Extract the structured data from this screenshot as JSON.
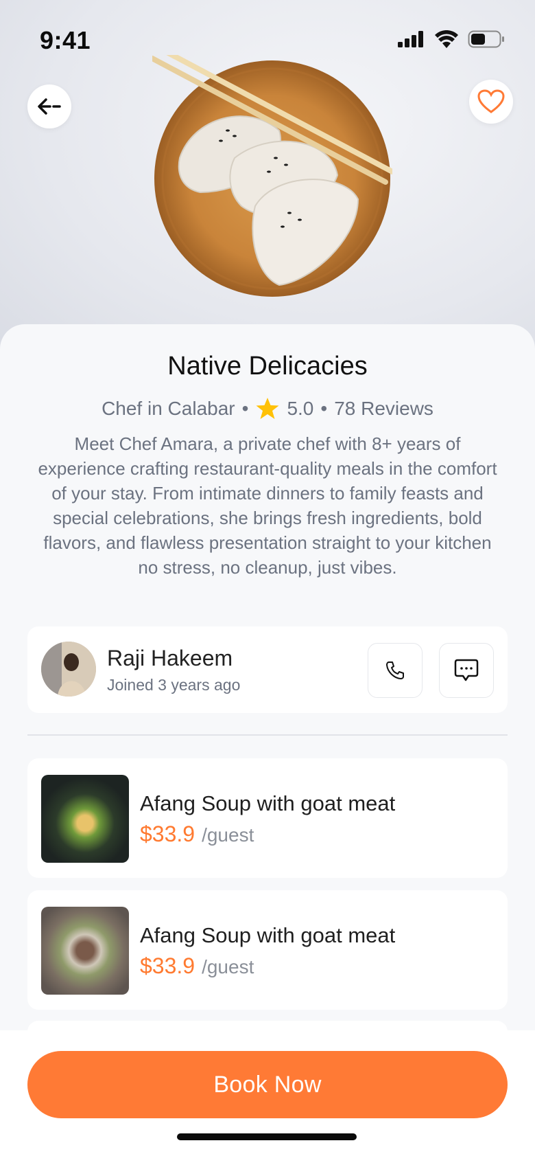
{
  "status": {
    "time": "9:41"
  },
  "hero": {
    "back_icon": "arrow-left-icon",
    "favorite_icon": "heart-icon"
  },
  "detail": {
    "title": "Native Delicacies",
    "location": "Chef in Calabar",
    "rating": "5.0",
    "reviews": "78 Reviews",
    "description": "Meet Chef Amara, a private chef with 8+ years of experience crafting restaurant-quality meals in the comfort of your stay. From intimate dinners to family feasts and special celebrations, she brings fresh ingredients, bold flavors, and flawless presentation straight to your kitchen no stress, no cleanup, just vibes."
  },
  "chef": {
    "name": "Raji Hakeem",
    "joined": "Joined 3 years ago",
    "call_icon": "phone-icon",
    "chat_icon": "chat-bubble-icon"
  },
  "menu": [
    {
      "name": "Afang Soup with goat meat",
      "price": "$33.9",
      "unit": "/guest"
    },
    {
      "name": "Afang Soup with goat meat",
      "price": "$33.9",
      "unit": "/guest"
    }
  ],
  "cta": {
    "label": "Book Now"
  },
  "colors": {
    "accent": "#FF7A35",
    "star": "#FFC107"
  }
}
